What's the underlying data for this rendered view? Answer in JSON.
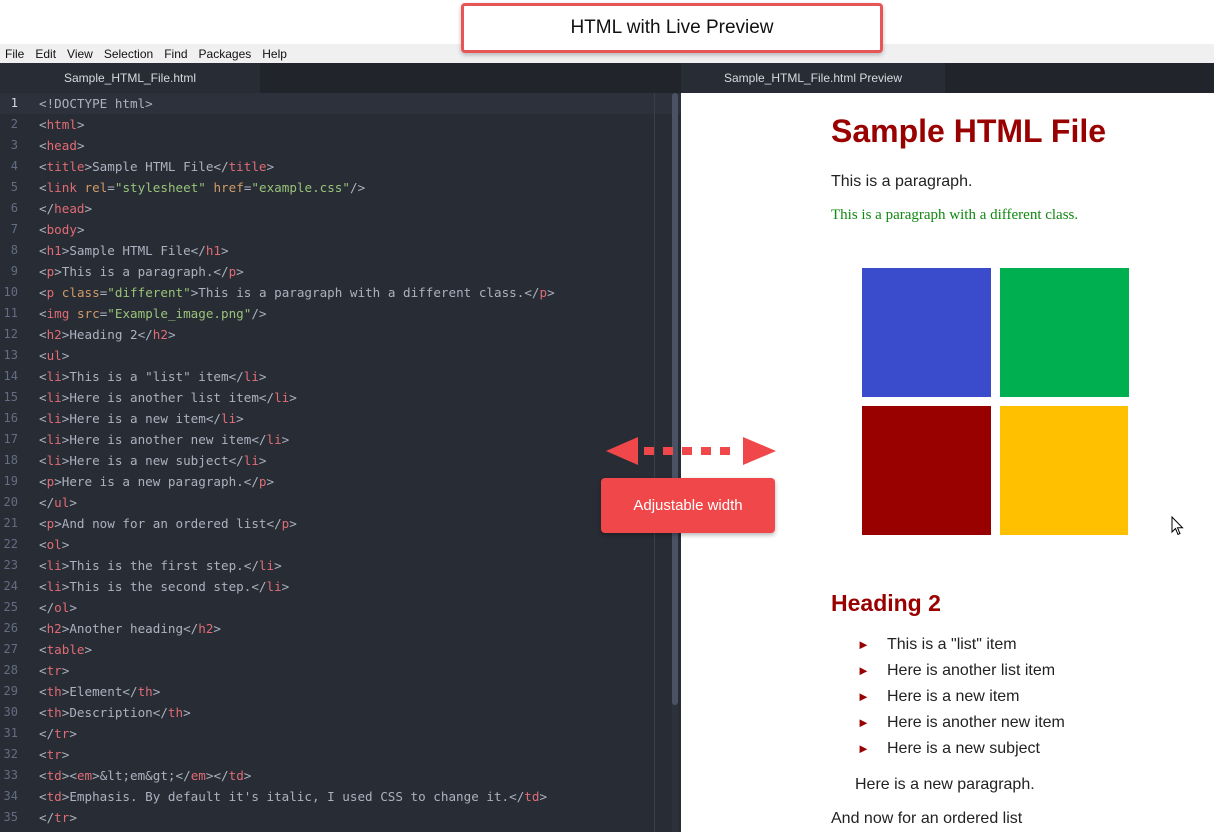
{
  "callouts": {
    "title": "HTML with Live Preview",
    "adjustable": "Adjustable width",
    "accent_color": "#e85556"
  },
  "menu": [
    "File",
    "Edit",
    "View",
    "Selection",
    "Find",
    "Packages",
    "Help"
  ],
  "tabs": {
    "editor": "Sample_HTML_File.html",
    "preview": "Sample_HTML_File.html Preview"
  },
  "editor": {
    "active_line": 1,
    "lines": [
      [
        [
          "tx",
          "<!DOCTYPE html>"
        ]
      ],
      [
        [
          "tx",
          "<"
        ],
        [
          "tg",
          "html"
        ],
        [
          "tx",
          ">"
        ]
      ],
      [
        [
          "tx",
          "<"
        ],
        [
          "tg",
          "head"
        ],
        [
          "tx",
          ">"
        ]
      ],
      [
        [
          "tx",
          "<"
        ],
        [
          "tg",
          "title"
        ],
        [
          "tx",
          ">Sample HTML File</"
        ],
        [
          "tg",
          "title"
        ],
        [
          "tx",
          ">"
        ]
      ],
      [
        [
          "tx",
          "<"
        ],
        [
          "tg",
          "link"
        ],
        [
          "tx",
          " "
        ],
        [
          "at",
          "rel"
        ],
        [
          "tx",
          "="
        ],
        [
          "st",
          "\"stylesheet\""
        ],
        [
          "tx",
          " "
        ],
        [
          "at",
          "href"
        ],
        [
          "tx",
          "="
        ],
        [
          "st",
          "\"example.css\""
        ],
        [
          "tx",
          "/>"
        ]
      ],
      [
        [
          "tx",
          "</"
        ],
        [
          "tg",
          "head"
        ],
        [
          "tx",
          ">"
        ]
      ],
      [
        [
          "tx",
          "<"
        ],
        [
          "tg",
          "body"
        ],
        [
          "tx",
          ">"
        ]
      ],
      [
        [
          "tx",
          "<"
        ],
        [
          "tg",
          "h1"
        ],
        [
          "tx",
          ">Sample HTML File</"
        ],
        [
          "tg",
          "h1"
        ],
        [
          "tx",
          ">"
        ]
      ],
      [
        [
          "tx",
          "<"
        ],
        [
          "tg",
          "p"
        ],
        [
          "tx",
          ">This is a paragraph.</"
        ],
        [
          "tg",
          "p"
        ],
        [
          "tx",
          ">"
        ]
      ],
      [
        [
          "tx",
          "<"
        ],
        [
          "tg",
          "p"
        ],
        [
          "tx",
          " "
        ],
        [
          "at",
          "class"
        ],
        [
          "tx",
          "="
        ],
        [
          "st",
          "\"different\""
        ],
        [
          "tx",
          ">This is a paragraph with a different class.</"
        ],
        [
          "tg",
          "p"
        ],
        [
          "tx",
          ">"
        ]
      ],
      [
        [
          "tx",
          "<"
        ],
        [
          "tg",
          "img"
        ],
        [
          "tx",
          " "
        ],
        [
          "at",
          "src"
        ],
        [
          "tx",
          "="
        ],
        [
          "st",
          "\"Example_image.png\""
        ],
        [
          "tx",
          "/>"
        ]
      ],
      [
        [
          "tx",
          "<"
        ],
        [
          "tg",
          "h2"
        ],
        [
          "tx",
          ">Heading 2</"
        ],
        [
          "tg",
          "h2"
        ],
        [
          "tx",
          ">"
        ]
      ],
      [
        [
          "tx",
          "<"
        ],
        [
          "tg",
          "ul"
        ],
        [
          "tx",
          ">"
        ]
      ],
      [
        [
          "tx",
          "<"
        ],
        [
          "tg",
          "li"
        ],
        [
          "tx",
          ">This is a \"list\" item</"
        ],
        [
          "tg",
          "li"
        ],
        [
          "tx",
          ">"
        ]
      ],
      [
        [
          "tx",
          "<"
        ],
        [
          "tg",
          "li"
        ],
        [
          "tx",
          ">Here is another list item</"
        ],
        [
          "tg",
          "li"
        ],
        [
          "tx",
          ">"
        ]
      ],
      [
        [
          "tx",
          "<"
        ],
        [
          "tg",
          "li"
        ],
        [
          "tx",
          ">Here is a new item</"
        ],
        [
          "tg",
          "li"
        ],
        [
          "tx",
          ">"
        ]
      ],
      [
        [
          "tx",
          "<"
        ],
        [
          "tg",
          "li"
        ],
        [
          "tx",
          ">Here is another new item</"
        ],
        [
          "tg",
          "li"
        ],
        [
          "tx",
          ">"
        ]
      ],
      [
        [
          "tx",
          "<"
        ],
        [
          "tg",
          "li"
        ],
        [
          "tx",
          ">Here is a new subject</"
        ],
        [
          "tg",
          "li"
        ],
        [
          "tx",
          ">"
        ]
      ],
      [
        [
          "tx",
          "<"
        ],
        [
          "tg",
          "p"
        ],
        [
          "tx",
          ">Here is a new paragraph.</"
        ],
        [
          "tg",
          "p"
        ],
        [
          "tx",
          ">"
        ]
      ],
      [
        [
          "tx",
          "</"
        ],
        [
          "tg",
          "ul"
        ],
        [
          "tx",
          ">"
        ]
      ],
      [
        [
          "tx",
          "<"
        ],
        [
          "tg",
          "p"
        ],
        [
          "tx",
          ">And now for an ordered list</"
        ],
        [
          "tg",
          "p"
        ],
        [
          "tx",
          ">"
        ]
      ],
      [
        [
          "tx",
          "<"
        ],
        [
          "tg",
          "ol"
        ],
        [
          "tx",
          ">"
        ]
      ],
      [
        [
          "tx",
          "<"
        ],
        [
          "tg",
          "li"
        ],
        [
          "tx",
          ">This is the first step.</"
        ],
        [
          "tg",
          "li"
        ],
        [
          "tx",
          ">"
        ]
      ],
      [
        [
          "tx",
          "<"
        ],
        [
          "tg",
          "li"
        ],
        [
          "tx",
          ">This is the second step.</"
        ],
        [
          "tg",
          "li"
        ],
        [
          "tx",
          ">"
        ]
      ],
      [
        [
          "tx",
          "</"
        ],
        [
          "tg",
          "ol"
        ],
        [
          "tx",
          ">"
        ]
      ],
      [
        [
          "tx",
          "<"
        ],
        [
          "tg",
          "h2"
        ],
        [
          "tx",
          ">Another heading</"
        ],
        [
          "tg",
          "h2"
        ],
        [
          "tx",
          ">"
        ]
      ],
      [
        [
          "tx",
          "<"
        ],
        [
          "tg",
          "table"
        ],
        [
          "tx",
          ">"
        ]
      ],
      [
        [
          "tx",
          "<"
        ],
        [
          "tg",
          "tr"
        ],
        [
          "tx",
          ">"
        ]
      ],
      [
        [
          "tx",
          "<"
        ],
        [
          "tg",
          "th"
        ],
        [
          "tx",
          ">Element</"
        ],
        [
          "tg",
          "th"
        ],
        [
          "tx",
          ">"
        ]
      ],
      [
        [
          "tx",
          "<"
        ],
        [
          "tg",
          "th"
        ],
        [
          "tx",
          ">Description</"
        ],
        [
          "tg",
          "th"
        ],
        [
          "tx",
          ">"
        ]
      ],
      [
        [
          "tx",
          "</"
        ],
        [
          "tg",
          "tr"
        ],
        [
          "tx",
          ">"
        ]
      ],
      [
        [
          "tx",
          "<"
        ],
        [
          "tg",
          "tr"
        ],
        [
          "tx",
          ">"
        ]
      ],
      [
        [
          "tx",
          "<"
        ],
        [
          "tg",
          "td"
        ],
        [
          "tx",
          "><"
        ],
        [
          "tg",
          "em"
        ],
        [
          "tx",
          ">&lt;em&gt;</"
        ],
        [
          "tg",
          "em"
        ],
        [
          "tx",
          "></"
        ],
        [
          "tg",
          "td"
        ],
        [
          "tx",
          ">"
        ]
      ],
      [
        [
          "tx",
          "<"
        ],
        [
          "tg",
          "td"
        ],
        [
          "tx",
          ">Emphasis. By default it's italic, I used CSS to change it.</"
        ],
        [
          "tg",
          "td"
        ],
        [
          "tx",
          ">"
        ]
      ],
      [
        [
          "tx",
          "</"
        ],
        [
          "tg",
          "tr"
        ],
        [
          "tx",
          ">"
        ]
      ]
    ]
  },
  "preview": {
    "h1": "Sample HTML File",
    "p1": "This is a paragraph.",
    "p2": "This is a paragraph with a different class.",
    "image_colors": [
      "#3a4bcb",
      "#00b050",
      "#990000",
      "#ffc000"
    ],
    "h2": "Heading 2",
    "list": [
      "This is a \"list\" item",
      "Here is another list item",
      "Here is a new item",
      "Here is another new item",
      "Here is a new subject"
    ],
    "p3": "Here is a new paragraph.",
    "p4": "And now for an ordered list",
    "heading_color": "#990000",
    "different_color": "#118811"
  }
}
